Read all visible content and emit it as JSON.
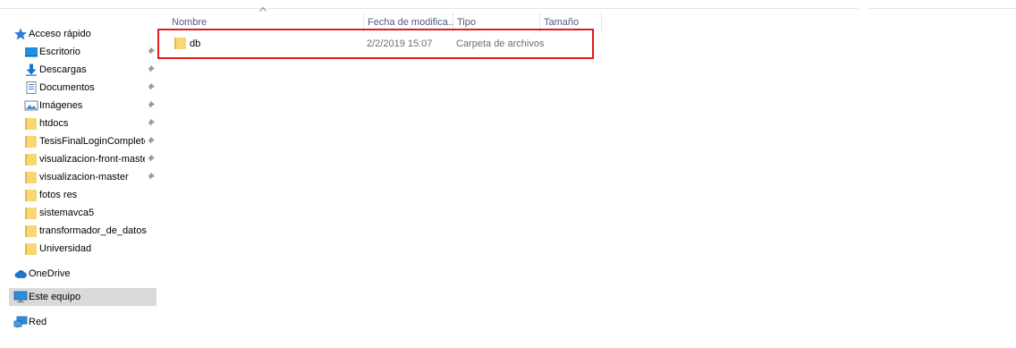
{
  "columns": {
    "name": "Nombre",
    "modified": "Fecha de modifica...",
    "type": "Tipo",
    "size": "Tamaño"
  },
  "nav": {
    "quick_access": "Acceso rápido",
    "items": [
      {
        "label": "Escritorio",
        "icon": "desktop-icon",
        "pinned": true
      },
      {
        "label": "Descargas",
        "icon": "download-icon",
        "pinned": true
      },
      {
        "label": "Documentos",
        "icon": "documents-icon",
        "pinned": true
      },
      {
        "label": "Imágenes",
        "icon": "pictures-icon",
        "pinned": true
      },
      {
        "label": "htdocs",
        "icon": "folder-icon",
        "pinned": true
      },
      {
        "label": "TesisFinalLoginComplete",
        "icon": "folder-icon",
        "pinned": true
      },
      {
        "label": "visualizacion-front-master",
        "icon": "folder-icon",
        "pinned": true
      },
      {
        "label": "visualizacion-master",
        "icon": "folder-icon",
        "pinned": true
      },
      {
        "label": "fotos res",
        "icon": "folder-icon",
        "pinned": false
      },
      {
        "label": "sistemavca5",
        "icon": "folder-icon",
        "pinned": false
      },
      {
        "label": "transformador_de_datos",
        "icon": "folder-icon",
        "pinned": false
      },
      {
        "label": "Universidad",
        "icon": "folder-icon",
        "pinned": false
      }
    ],
    "onedrive": "OneDrive",
    "this_pc": "Este equipo",
    "network": "Red"
  },
  "files": [
    {
      "name": "db",
      "modified": "2/2/2019 15:07",
      "type": "Carpeta de archivos",
      "size": ""
    }
  ],
  "colors": {
    "folder": "#f7d774",
    "folder_dark": "#e4b948",
    "star": "#2d7fd4",
    "selected": "#d9d9d9",
    "highlight": "#e3191c",
    "header_text": "#4c607a"
  }
}
